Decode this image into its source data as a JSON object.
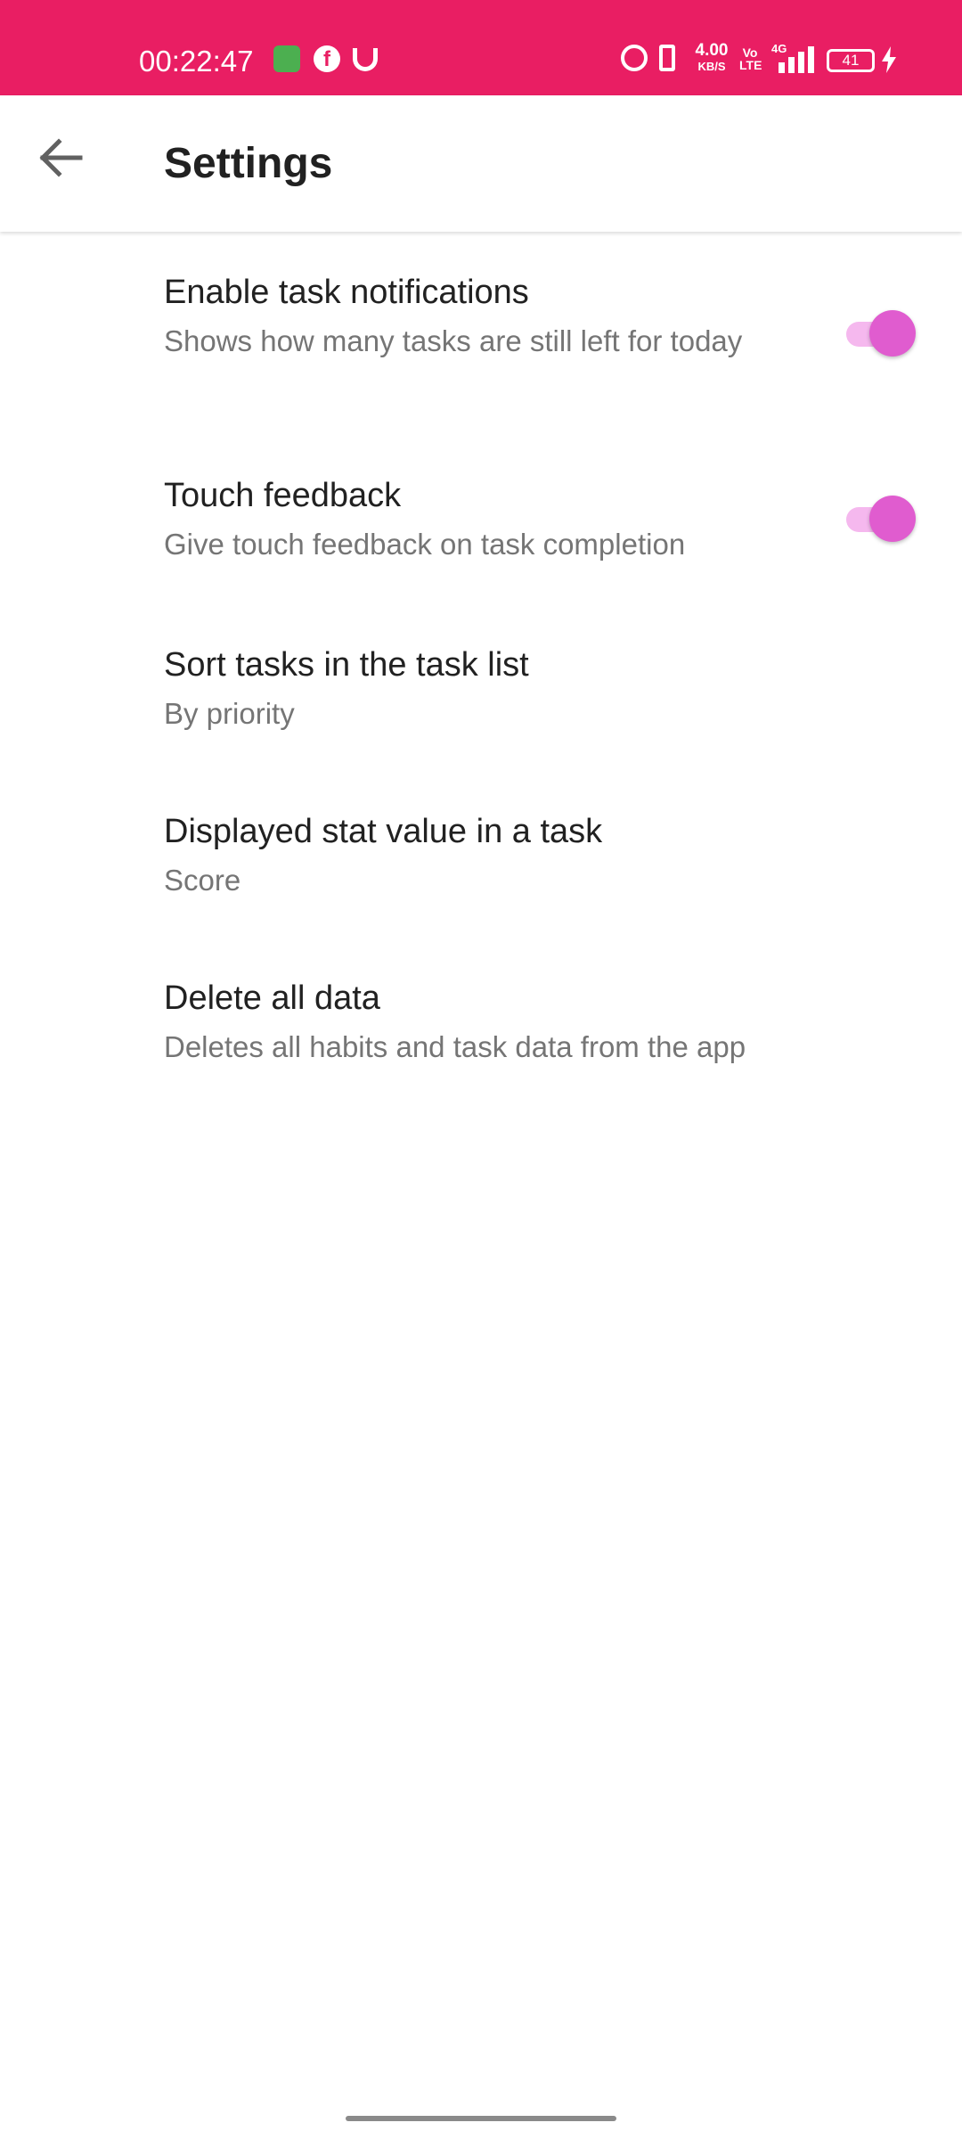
{
  "status_bar": {
    "time": "00:22:47",
    "network_speed_value": "4.00",
    "network_speed_unit": "KB/S",
    "volte_label": "Vo\nLTE",
    "network_type": "4G",
    "battery_level": "41",
    "background_color": "#e91e63"
  },
  "app_bar": {
    "title": "Settings",
    "back_icon": "arrow-left-icon"
  },
  "settings": [
    {
      "title": "Enable task notifications",
      "summary": "Shows how many tasks are still left for today",
      "toggle": true,
      "enabled": true
    },
    {
      "title": "Touch feedback",
      "summary": "Give touch feedback on task completion",
      "toggle": true,
      "enabled": true
    },
    {
      "title": "Sort tasks in the task list",
      "summary": "By priority",
      "toggle": false
    },
    {
      "title": "Displayed stat value in a task",
      "summary": "Score",
      "toggle": false
    },
    {
      "title": "Delete all data",
      "summary": "Deletes all habits and task data from the app",
      "toggle": false
    }
  ],
  "colors": {
    "accent": "#e05ccf",
    "accent_track": "#f5b8ee",
    "title_text": "#212121",
    "summary_text": "#757575"
  }
}
